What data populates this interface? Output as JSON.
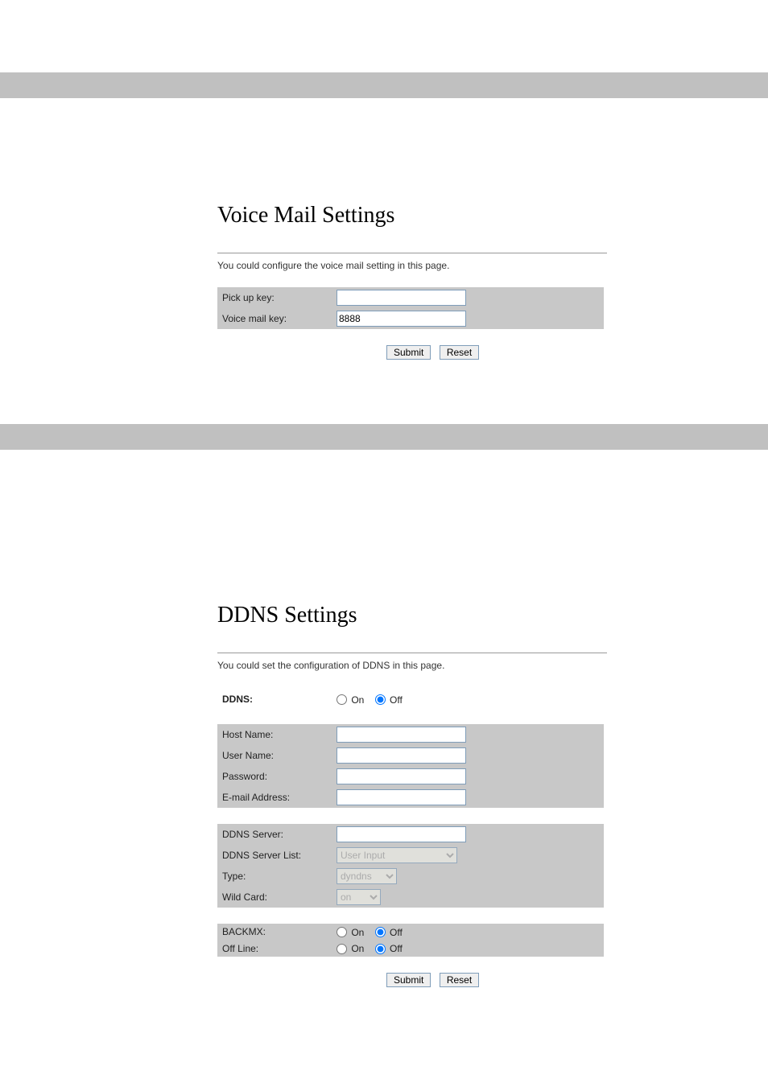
{
  "section1": {
    "title": "Voice Mail Settings",
    "description": "You could configure the voice mail setting in this page.",
    "fields": {
      "pickup_label": "Pick up key:",
      "pickup_value": "",
      "voicemail_label": "Voice mail key:",
      "voicemail_value": "8888"
    },
    "buttons": {
      "submit": "Submit",
      "reset": "Reset"
    }
  },
  "section2": {
    "title": "DDNS Settings",
    "description": "You could set the configuration of DDNS in this page.",
    "ddns_label": "DDNS:",
    "ddns_on": "On",
    "ddns_off": "Off",
    "fields1": {
      "hostname_label": "Host Name:",
      "hostname_value": "",
      "username_label": "User Name:",
      "username_value": "",
      "password_label": "Password:",
      "password_value": "",
      "email_label": "E-mail Address:",
      "email_value": ""
    },
    "fields2": {
      "server_label": "DDNS Server:",
      "server_value": "",
      "serverlist_label": "DDNS Server List:",
      "serverlist_value": "User Input",
      "type_label": "Type:",
      "type_value": "dyndns",
      "wildcard_label": "Wild Card:",
      "wildcard_value": "on"
    },
    "fields3": {
      "backmx_label": "BACKMX:",
      "backmx_on": "On",
      "backmx_off": "Off",
      "offline_label": "Off Line:",
      "offline_on": "On",
      "offline_off": "Off"
    },
    "buttons": {
      "submit": "Submit",
      "reset": "Reset"
    }
  }
}
